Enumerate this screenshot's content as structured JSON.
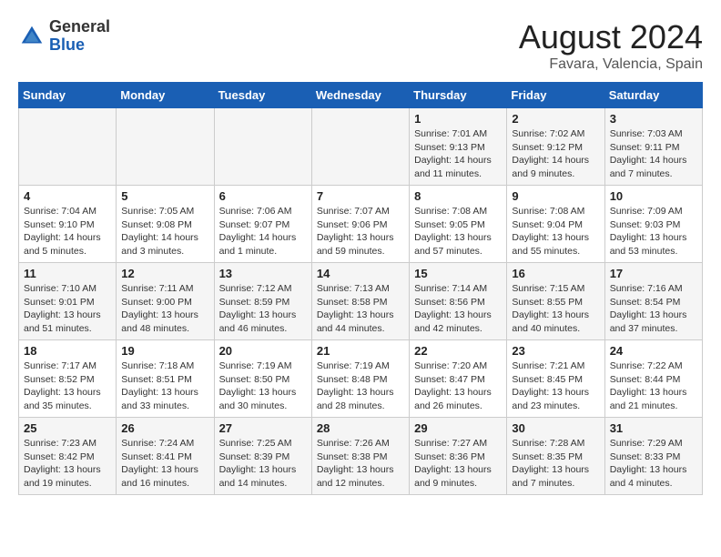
{
  "header": {
    "logo_general": "General",
    "logo_blue": "Blue",
    "month": "August 2024",
    "location": "Favara, Valencia, Spain"
  },
  "weekdays": [
    "Sunday",
    "Monday",
    "Tuesday",
    "Wednesday",
    "Thursday",
    "Friday",
    "Saturday"
  ],
  "weeks": [
    [
      {
        "day": "",
        "sunrise": "",
        "sunset": "",
        "daylight": ""
      },
      {
        "day": "",
        "sunrise": "",
        "sunset": "",
        "daylight": ""
      },
      {
        "day": "",
        "sunrise": "",
        "sunset": "",
        "daylight": ""
      },
      {
        "day": "",
        "sunrise": "",
        "sunset": "",
        "daylight": ""
      },
      {
        "day": "1",
        "sunrise": "Sunrise: 7:01 AM",
        "sunset": "Sunset: 9:13 PM",
        "daylight": "Daylight: 14 hours and 11 minutes."
      },
      {
        "day": "2",
        "sunrise": "Sunrise: 7:02 AM",
        "sunset": "Sunset: 9:12 PM",
        "daylight": "Daylight: 14 hours and 9 minutes."
      },
      {
        "day": "3",
        "sunrise": "Sunrise: 7:03 AM",
        "sunset": "Sunset: 9:11 PM",
        "daylight": "Daylight: 14 hours and 7 minutes."
      }
    ],
    [
      {
        "day": "4",
        "sunrise": "Sunrise: 7:04 AM",
        "sunset": "Sunset: 9:10 PM",
        "daylight": "Daylight: 14 hours and 5 minutes."
      },
      {
        "day": "5",
        "sunrise": "Sunrise: 7:05 AM",
        "sunset": "Sunset: 9:08 PM",
        "daylight": "Daylight: 14 hours and 3 minutes."
      },
      {
        "day": "6",
        "sunrise": "Sunrise: 7:06 AM",
        "sunset": "Sunset: 9:07 PM",
        "daylight": "Daylight: 14 hours and 1 minute."
      },
      {
        "day": "7",
        "sunrise": "Sunrise: 7:07 AM",
        "sunset": "Sunset: 9:06 PM",
        "daylight": "Daylight: 13 hours and 59 minutes."
      },
      {
        "day": "8",
        "sunrise": "Sunrise: 7:08 AM",
        "sunset": "Sunset: 9:05 PM",
        "daylight": "Daylight: 13 hours and 57 minutes."
      },
      {
        "day": "9",
        "sunrise": "Sunrise: 7:08 AM",
        "sunset": "Sunset: 9:04 PM",
        "daylight": "Daylight: 13 hours and 55 minutes."
      },
      {
        "day": "10",
        "sunrise": "Sunrise: 7:09 AM",
        "sunset": "Sunset: 9:03 PM",
        "daylight": "Daylight: 13 hours and 53 minutes."
      }
    ],
    [
      {
        "day": "11",
        "sunrise": "Sunrise: 7:10 AM",
        "sunset": "Sunset: 9:01 PM",
        "daylight": "Daylight: 13 hours and 51 minutes."
      },
      {
        "day": "12",
        "sunrise": "Sunrise: 7:11 AM",
        "sunset": "Sunset: 9:00 PM",
        "daylight": "Daylight: 13 hours and 48 minutes."
      },
      {
        "day": "13",
        "sunrise": "Sunrise: 7:12 AM",
        "sunset": "Sunset: 8:59 PM",
        "daylight": "Daylight: 13 hours and 46 minutes."
      },
      {
        "day": "14",
        "sunrise": "Sunrise: 7:13 AM",
        "sunset": "Sunset: 8:58 PM",
        "daylight": "Daylight: 13 hours and 44 minutes."
      },
      {
        "day": "15",
        "sunrise": "Sunrise: 7:14 AM",
        "sunset": "Sunset: 8:56 PM",
        "daylight": "Daylight: 13 hours and 42 minutes."
      },
      {
        "day": "16",
        "sunrise": "Sunrise: 7:15 AM",
        "sunset": "Sunset: 8:55 PM",
        "daylight": "Daylight: 13 hours and 40 minutes."
      },
      {
        "day": "17",
        "sunrise": "Sunrise: 7:16 AM",
        "sunset": "Sunset: 8:54 PM",
        "daylight": "Daylight: 13 hours and 37 minutes."
      }
    ],
    [
      {
        "day": "18",
        "sunrise": "Sunrise: 7:17 AM",
        "sunset": "Sunset: 8:52 PM",
        "daylight": "Daylight: 13 hours and 35 minutes."
      },
      {
        "day": "19",
        "sunrise": "Sunrise: 7:18 AM",
        "sunset": "Sunset: 8:51 PM",
        "daylight": "Daylight: 13 hours and 33 minutes."
      },
      {
        "day": "20",
        "sunrise": "Sunrise: 7:19 AM",
        "sunset": "Sunset: 8:50 PM",
        "daylight": "Daylight: 13 hours and 30 minutes."
      },
      {
        "day": "21",
        "sunrise": "Sunrise: 7:19 AM",
        "sunset": "Sunset: 8:48 PM",
        "daylight": "Daylight: 13 hours and 28 minutes."
      },
      {
        "day": "22",
        "sunrise": "Sunrise: 7:20 AM",
        "sunset": "Sunset: 8:47 PM",
        "daylight": "Daylight: 13 hours and 26 minutes."
      },
      {
        "day": "23",
        "sunrise": "Sunrise: 7:21 AM",
        "sunset": "Sunset: 8:45 PM",
        "daylight": "Daylight: 13 hours and 23 minutes."
      },
      {
        "day": "24",
        "sunrise": "Sunrise: 7:22 AM",
        "sunset": "Sunset: 8:44 PM",
        "daylight": "Daylight: 13 hours and 21 minutes."
      }
    ],
    [
      {
        "day": "25",
        "sunrise": "Sunrise: 7:23 AM",
        "sunset": "Sunset: 8:42 PM",
        "daylight": "Daylight: 13 hours and 19 minutes."
      },
      {
        "day": "26",
        "sunrise": "Sunrise: 7:24 AM",
        "sunset": "Sunset: 8:41 PM",
        "daylight": "Daylight: 13 hours and 16 minutes."
      },
      {
        "day": "27",
        "sunrise": "Sunrise: 7:25 AM",
        "sunset": "Sunset: 8:39 PM",
        "daylight": "Daylight: 13 hours and 14 minutes."
      },
      {
        "day": "28",
        "sunrise": "Sunrise: 7:26 AM",
        "sunset": "Sunset: 8:38 PM",
        "daylight": "Daylight: 13 hours and 12 minutes."
      },
      {
        "day": "29",
        "sunrise": "Sunrise: 7:27 AM",
        "sunset": "Sunset: 8:36 PM",
        "daylight": "Daylight: 13 hours and 9 minutes."
      },
      {
        "day": "30",
        "sunrise": "Sunrise: 7:28 AM",
        "sunset": "Sunset: 8:35 PM",
        "daylight": "Daylight: 13 hours and 7 minutes."
      },
      {
        "day": "31",
        "sunrise": "Sunrise: 7:29 AM",
        "sunset": "Sunset: 8:33 PM",
        "daylight": "Daylight: 13 hours and 4 minutes."
      }
    ]
  ]
}
